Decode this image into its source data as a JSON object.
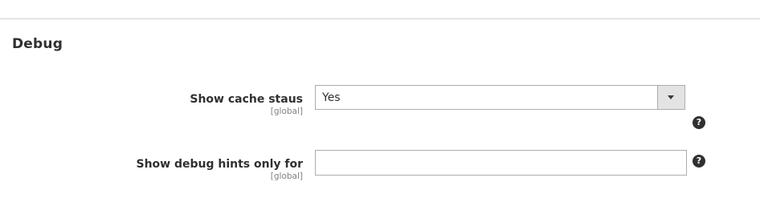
{
  "section": {
    "title": "Debug"
  },
  "fields": [
    {
      "label": "Show cache staus",
      "scope": "[global]",
      "type": "select",
      "value": "Yes",
      "help_icon": "question-circle-icon"
    },
    {
      "label": "Show debug hints only for",
      "scope": "[global]",
      "type": "text",
      "value": "",
      "help_icon": "question-circle-icon"
    }
  ],
  "icons": {
    "help_glyph": "?",
    "dropdown": "chevron-down-icon"
  },
  "colors": {
    "text": "#303030",
    "scope_text": "#808080",
    "border": "#adadad",
    "arrow_bg": "#e3e3e3",
    "help_bg": "#303030"
  }
}
